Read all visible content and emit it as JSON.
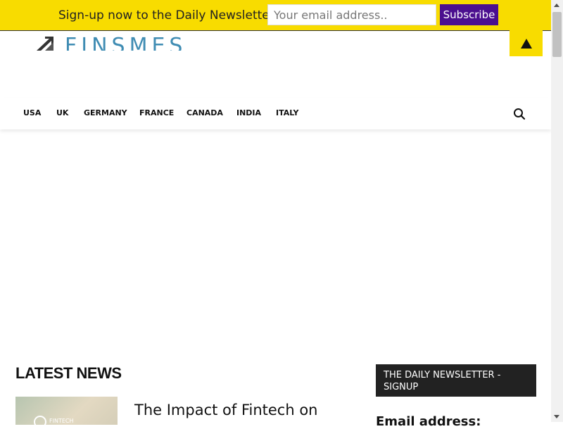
{
  "newsletter_bar": {
    "message": "Sign-up now to the Daily Newsletter",
    "email_placeholder": "Your email address..",
    "subscribe_label": "Subscribe",
    "background": "#f8dc00",
    "button_color": "#4b0f8f"
  },
  "scroll_top": {
    "icon": "triangle-up-icon"
  },
  "header": {
    "logo_text": "FINSMES",
    "logo_color": "#3f8cb3"
  },
  "nav": {
    "items": [
      "USA",
      "UK",
      "GERMANY",
      "FRANCE",
      "CANADA",
      "INDIA",
      "ITALY"
    ],
    "search_icon": "search-icon"
  },
  "main": {
    "section_title": "LATEST NEWS",
    "articles": [
      {
        "headline": "The Impact of Fintech on",
        "category": "FINTECH"
      }
    ]
  },
  "sidebar": {
    "box_title": "THE DAILY NEWSLETTER - SIGNUP",
    "email_label": "Email address:"
  }
}
